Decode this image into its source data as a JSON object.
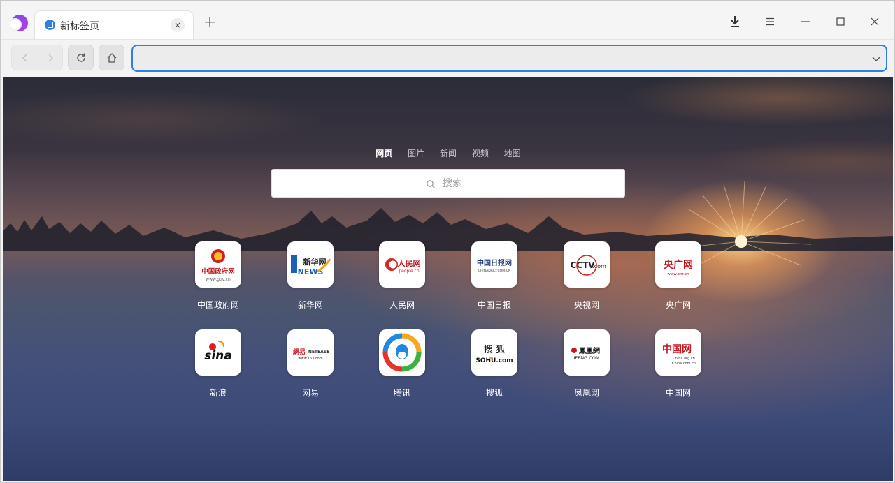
{
  "tab": {
    "title": "新标签页",
    "close_label": "×"
  },
  "new_tab_label": "+",
  "address_bar": {
    "value": ""
  },
  "search": {
    "tabs": [
      "网页",
      "图片",
      "新闻",
      "视频",
      "地图"
    ],
    "active_tab": 0,
    "placeholder": "搜索"
  },
  "shortcuts": [
    {
      "label": "中国政府网",
      "logo": [
        "中国政府网",
        "www.gov.cn"
      ],
      "icon": "china-gov-icon"
    },
    {
      "label": "新华网",
      "logo": [
        "新华网",
        "NEWS"
      ],
      "icon": "xinhua-icon"
    },
    {
      "label": "人民网",
      "logo": [
        "人民网",
        "people.cn"
      ],
      "icon": "people-icon"
    },
    {
      "label": "中国日报",
      "logo": [
        "中国日报网",
        "CHINADAILY.COM.CN"
      ],
      "icon": "chinadaily-icon"
    },
    {
      "label": "央视网",
      "logo": [
        "CCTV",
        ".com"
      ],
      "icon": "cctv-icon"
    },
    {
      "label": "央广网",
      "logo": [
        "央广网",
        "www.cnr.cn"
      ],
      "icon": "cnr-icon"
    },
    {
      "label": "新浪",
      "logo": [
        "sina"
      ],
      "icon": "sina-icon"
    },
    {
      "label": "网易",
      "logo": [
        "網易",
        "NETEASE",
        "www.163.com"
      ],
      "icon": "netease-icon"
    },
    {
      "label": "腾讯",
      "logo": [],
      "icon": "tencent-icon"
    },
    {
      "label": "搜狐",
      "logo": [
        "搜 狐",
        "SOHU.com"
      ],
      "icon": "sohu-icon"
    },
    {
      "label": "凤凰网",
      "logo": [
        "鳳凰網",
        "IFENG.COM"
      ],
      "icon": "ifeng-icon"
    },
    {
      "label": "中国网",
      "logo": [
        "中国网",
        "China.org.cn",
        "China.com.cn"
      ],
      "icon": "china-net-icon"
    }
  ],
  "colors": {
    "accent": "#2f7fe3",
    "tab_bg": "#ffffff",
    "titlebar_bg": "#f5f5f5"
  }
}
